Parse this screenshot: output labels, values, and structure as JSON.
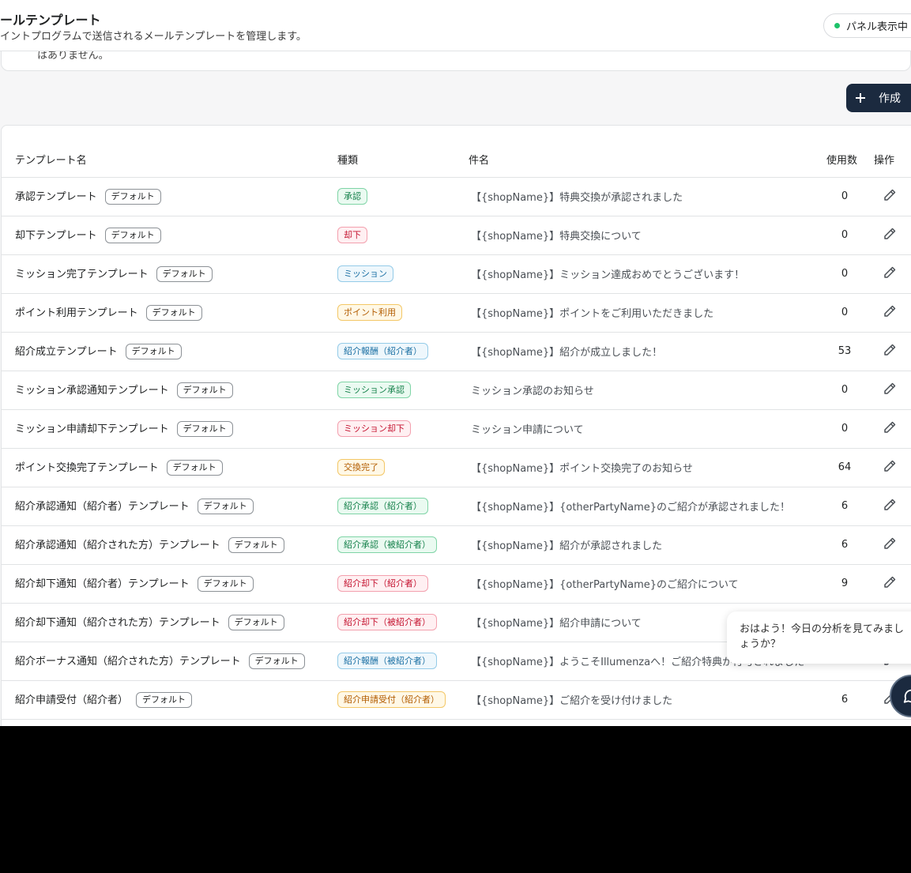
{
  "header": {
    "title": "ールテンプレート",
    "subtitle": "イントプログラムで送信されるメールテンプレートを管理します。",
    "panel_status": "パネル表示中"
  },
  "notice": {
    "text": "はありません。"
  },
  "toolbar": {
    "create_label": "作成"
  },
  "table": {
    "columns": {
      "name": "テンプレート名",
      "type": "種類",
      "subject": "件名",
      "count": "使用数",
      "action": "操作"
    },
    "rows": [
      {
        "name": "承認テンプレート",
        "badge": "デフォルト",
        "type": "承認",
        "tone": "green",
        "subject": "【{shopName}】特典交換が承認されました",
        "count": "0"
      },
      {
        "name": "却下テンプレート",
        "badge": "デフォルト",
        "type": "却下",
        "tone": "red",
        "subject": "【{shopName}】特典交換について",
        "count": "0"
      },
      {
        "name": "ミッション完了テンプレート",
        "badge": "デフォルト",
        "type": "ミッション",
        "tone": "blue",
        "subject": "【{shopName}】ミッション達成おめでとうございます！",
        "count": "0"
      },
      {
        "name": "ポイント利用テンプレート",
        "badge": "デフォルト",
        "type": "ポイント利用",
        "tone": "orange",
        "subject": "【{shopName}】ポイントをご利用いただきました",
        "count": "0"
      },
      {
        "name": "紹介成立テンプレート",
        "badge": "デフォルト",
        "type": "紹介報酬（紹介者）",
        "tone": "blue",
        "subject": "【{shopName}】紹介が成立しました！",
        "count": "53"
      },
      {
        "name": "ミッション承認通知テンプレート",
        "badge": "デフォルト",
        "type": "ミッション承認",
        "tone": "green",
        "subject": "ミッション承認のお知らせ",
        "count": "0"
      },
      {
        "name": "ミッション申請却下テンプレート",
        "badge": "デフォルト",
        "type": "ミッション却下",
        "tone": "red",
        "subject": "ミッション申請について",
        "count": "0"
      },
      {
        "name": "ポイント交換完了テンプレート",
        "badge": "デフォルト",
        "type": "交換完了",
        "tone": "orange",
        "subject": "【{shopName}】ポイント交換完了のお知らせ",
        "count": "64"
      },
      {
        "name": "紹介承認通知（紹介者）テンプレート",
        "badge": "デフォルト",
        "type": "紹介承認（紹介者）",
        "tone": "green",
        "subject": "【{shopName}】{otherPartyName}のご紹介が承認されました！",
        "count": "6"
      },
      {
        "name": "紹介承認通知（紹介された方）テンプレート",
        "badge": "デフォルト",
        "type": "紹介承認（被紹介者）",
        "tone": "green",
        "subject": "【{shopName}】紹介が承認されました",
        "count": "6"
      },
      {
        "name": "紹介却下通知（紹介者）テンプレート",
        "badge": "デフォルト",
        "type": "紹介却下（紹介者）",
        "tone": "red",
        "subject": "【{shopName}】{otherPartyName}のご紹介について",
        "count": "9"
      },
      {
        "name": "紹介却下通知（紹介された方）テンプレート",
        "badge": "デフォルト",
        "type": "紹介却下（被紹介者）",
        "tone": "red",
        "subject": "【{shopName}】紹介申請について",
        "count": ""
      },
      {
        "name": "紹介ボーナス通知（紹介された方）テンプレート",
        "badge": "デフォルト",
        "type": "紹介報酬（被紹介者）",
        "tone": "blue",
        "subject": "【{shopName}】ようこそIllumenzaへ！ご紹介特典が付与されました",
        "count": ""
      },
      {
        "name": "紹介申請受付（紹介者）",
        "badge": "デフォルト",
        "type": "紹介申請受付（紹介者）",
        "tone": "orange",
        "subject": "【{shopName}】ご紹介を受け付けました",
        "count": "6"
      }
    ]
  },
  "chat": {
    "greeting": "おはよう！今日の分析を見てみましょうか？"
  },
  "colors": {
    "green_bg": "#eafaf1",
    "green_border": "#7fd4a6",
    "green_text": "#14804a",
    "red_bg": "#fff0f2",
    "red_border": "#f3a0ae",
    "red_text": "#c4122f",
    "blue_bg": "#eef7fc",
    "blue_border": "#94cbe8",
    "blue_text": "#1a6fa3",
    "orange_bg": "#fff8e6",
    "orange_border": "#f3c766",
    "orange_text": "#b25c00",
    "primary": "#1b2a3f"
  },
  "icons": {
    "edit": "pencil-icon",
    "add": "plus-icon",
    "chat": "chat-icon",
    "status": "status-dot"
  }
}
